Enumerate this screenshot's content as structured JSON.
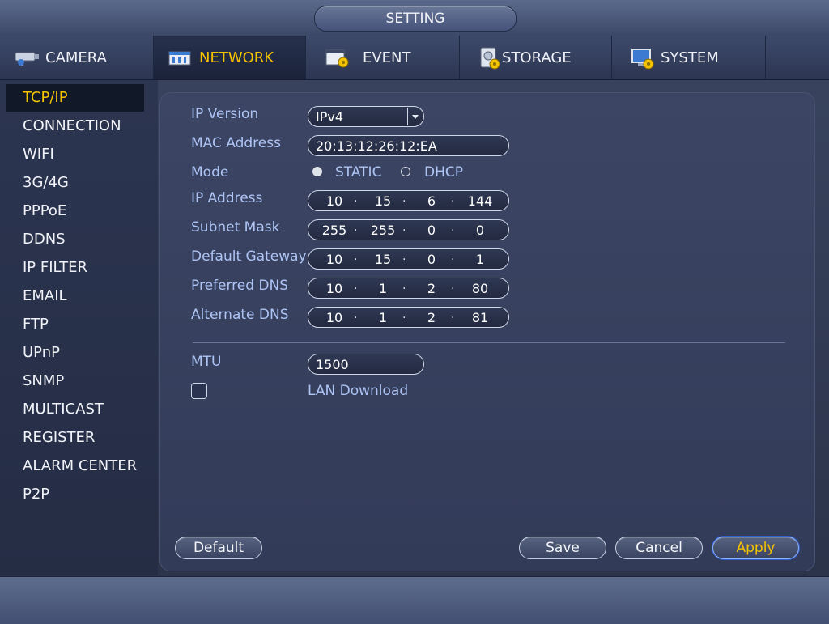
{
  "window": {
    "title": "SETTING"
  },
  "tabs": [
    {
      "label": "CAMERA",
      "icon": "camera-icon",
      "active": false
    },
    {
      "label": "NETWORK",
      "icon": "network-icon",
      "active": true
    },
    {
      "label": "EVENT",
      "icon": "event-icon",
      "active": false
    },
    {
      "label": "STORAGE",
      "icon": "storage-icon",
      "active": false
    },
    {
      "label": "SYSTEM",
      "icon": "system-icon",
      "active": false
    }
  ],
  "sidebar": {
    "items": [
      {
        "label": "TCP/IP",
        "active": true
      },
      {
        "label": "CONNECTION"
      },
      {
        "label": "WIFI"
      },
      {
        "label": "3G/4G"
      },
      {
        "label": "PPPoE"
      },
      {
        "label": "DDNS"
      },
      {
        "label": "IP FILTER"
      },
      {
        "label": "EMAIL"
      },
      {
        "label": "FTP"
      },
      {
        "label": "UPnP"
      },
      {
        "label": "SNMP"
      },
      {
        "label": "MULTICAST"
      },
      {
        "label": "REGISTER"
      },
      {
        "label": "ALARM CENTER"
      },
      {
        "label": "P2P"
      }
    ]
  },
  "form": {
    "ip_version": {
      "label": "IP Version",
      "value": "IPv4"
    },
    "mac_address": {
      "label": "MAC Address",
      "value": "20:13:12:26:12:EA"
    },
    "mode": {
      "label": "Mode",
      "options": [
        "STATIC",
        "DHCP"
      ],
      "selected": "STATIC"
    },
    "ip_address": {
      "label": "IP Address",
      "octets": [
        "10",
        "15",
        "6",
        "144"
      ]
    },
    "subnet_mask": {
      "label": "Subnet Mask",
      "octets": [
        "255",
        "255",
        "0",
        "0"
      ]
    },
    "default_gateway": {
      "label": "Default Gateway",
      "octets": [
        "10",
        "15",
        "0",
        "1"
      ]
    },
    "preferred_dns": {
      "label": "Preferred DNS",
      "octets": [
        "10",
        "1",
        "2",
        "80"
      ]
    },
    "alternate_dns": {
      "label": "Alternate DNS",
      "octets": [
        "10",
        "1",
        "2",
        "81"
      ]
    },
    "mtu": {
      "label": "MTU",
      "value": "1500"
    },
    "lan_download": {
      "label": "LAN Download",
      "checked": false
    }
  },
  "buttons": {
    "default": "Default",
    "save": "Save",
    "cancel": "Cancel",
    "apply": "Apply"
  },
  "colors": {
    "accent": "#f5c400",
    "label": "#aec4f5"
  }
}
